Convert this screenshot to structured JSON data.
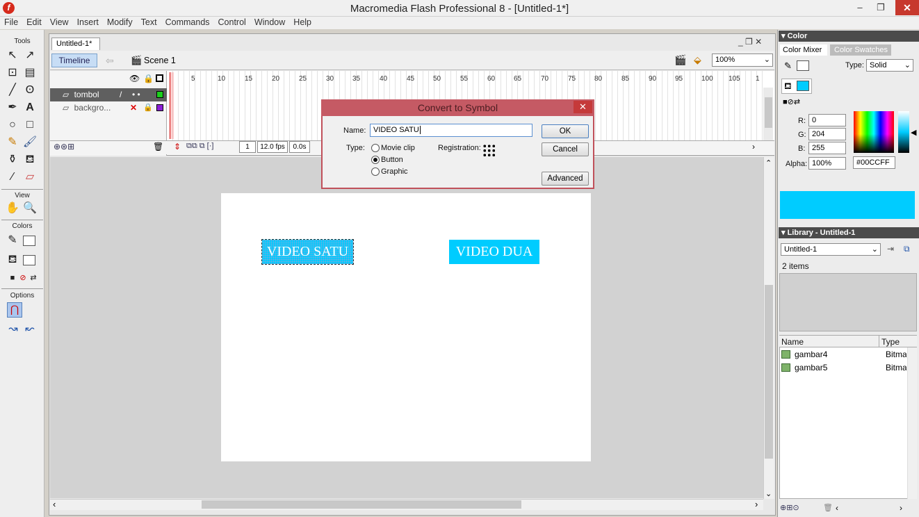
{
  "window": {
    "title": "Macromedia Flash Professional 8 - [Untitled-1*]",
    "min": "–",
    "max": "❐",
    "close": "✕"
  },
  "menu": [
    "File",
    "Edit",
    "View",
    "Insert",
    "Modify",
    "Text",
    "Commands",
    "Control",
    "Window",
    "Help"
  ],
  "tools": {
    "title": "Tools",
    "view_title": "View",
    "colors_title": "Colors",
    "options_title": "Options"
  },
  "document": {
    "tab": "Untitled-1*",
    "timeline_button": "Timeline",
    "scene": "Scene 1",
    "zoom": "100%",
    "layers": [
      {
        "name": "tombol",
        "status": "•  •"
      },
      {
        "name": "backgro...",
        "status": "✕"
      }
    ],
    "ruler": [
      "5",
      "10",
      "15",
      "20",
      "25",
      "30",
      "35",
      "40",
      "45",
      "50",
      "55",
      "60",
      "65",
      "70",
      "75",
      "80",
      "85",
      "90",
      "95",
      "100",
      "105",
      "1"
    ],
    "frame": "1",
    "fps": "12.0 fps",
    "time": "0.0s"
  },
  "stage": {
    "button1": "VIDEO SATU",
    "button2": "VIDEO DUA"
  },
  "dialog": {
    "title": "Convert to Symbol",
    "name_label": "Name:",
    "name_value": "VIDEO SATU",
    "type_label": "Type:",
    "types": [
      "Movie clip",
      "Button",
      "Graphic"
    ],
    "selected": "Button",
    "registration_label": "Registration:",
    "ok": "OK",
    "cancel": "Cancel",
    "advanced": "Advanced"
  },
  "color_panel": {
    "title": "Color",
    "tab_mixer": "Color Mixer",
    "tab_swatches": "Color Swatches",
    "type_label": "Type:",
    "type_value": "Solid",
    "r_label": "R:",
    "r": "0",
    "g_label": "G:",
    "g": "204",
    "b_label": "B:",
    "b": "255",
    "alpha_label": "Alpha:",
    "alpha": "100%",
    "hex": "#00CCFF"
  },
  "library": {
    "title": "Library - Untitled-1",
    "doc": "Untitled-1",
    "count": "2 items",
    "col_name": "Name",
    "col_type": "Type",
    "items": [
      {
        "name": "gambar4",
        "type": "Bitmap"
      },
      {
        "name": "gambar5",
        "type": "Bitmap"
      }
    ]
  },
  "accent": "#00ccff"
}
